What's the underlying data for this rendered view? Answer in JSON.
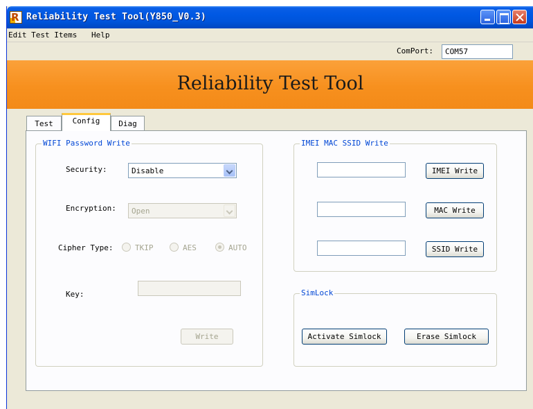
{
  "window": {
    "title": "Reliability Test Tool(Y850_V0.3)",
    "icon_letter": "R"
  },
  "menu": {
    "items": [
      "Edit Test Items",
      "Help"
    ]
  },
  "comport": {
    "label": "ComPort:",
    "value": "COM57"
  },
  "banner": {
    "title": "Reliability Test Tool",
    "color": "#f7901e"
  },
  "tabs": [
    {
      "label": "Test",
      "active": false
    },
    {
      "label": "Config",
      "active": true
    },
    {
      "label": "Diag",
      "active": false
    }
  ],
  "wifi": {
    "group_title": "WIFI Password Write",
    "security_label": "Security:",
    "security_value": "Disable",
    "encryption_label": "Encryption:",
    "encryption_value": "Open",
    "cipher_label": "Cipher Type:",
    "cipher_options": [
      {
        "label": "TKIP",
        "checked": false
      },
      {
        "label": "AES",
        "checked": false
      },
      {
        "label": "AUTO",
        "checked": true
      }
    ],
    "key_label": "Key:",
    "key_value": "",
    "write_button": "Write"
  },
  "imei_group": {
    "group_title": "IMEI MAC SSID Write",
    "imei_value": "",
    "imei_button": "IMEI Write",
    "mac_value": "",
    "mac_button": "MAC Write",
    "ssid_value": "",
    "ssid_button": "SSID Write"
  },
  "simlock": {
    "group_title": "SimLock",
    "activate_button": "Activate Simlock",
    "erase_button": "Erase Simlock"
  }
}
